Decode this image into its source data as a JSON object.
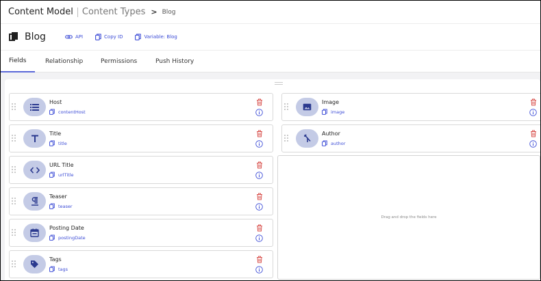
{
  "breadcrumb": {
    "root": "Content Model",
    "section": "Content Types",
    "arrow": ">",
    "current": "Blog"
  },
  "content_type": {
    "title": "Blog",
    "links": [
      {
        "label": "API",
        "icon": "link-icon"
      },
      {
        "label": "Copy ID",
        "icon": "copy-icon"
      },
      {
        "label": "Variable: Blog",
        "icon": "copy-icon"
      }
    ]
  },
  "tabs": [
    {
      "label": "Fields",
      "active": true
    },
    {
      "label": "Relationship",
      "active": false
    },
    {
      "label": "Permissions",
      "active": false
    },
    {
      "label": "Push History",
      "active": false
    }
  ],
  "fields_left": [
    {
      "name": "Host",
      "variable": "contentHost",
      "icon": "list-icon"
    },
    {
      "name": "Title",
      "variable": "title",
      "icon": "text-icon"
    },
    {
      "name": "URL Title",
      "variable": "urlTitle",
      "icon": "code-icon"
    },
    {
      "name": "Teaser",
      "variable": "teaser",
      "icon": "paragraph-icon"
    },
    {
      "name": "Posting Date",
      "variable": "postingDate",
      "icon": "calendar-icon"
    },
    {
      "name": "Tags",
      "variable": "tags",
      "icon": "tag-icon"
    }
  ],
  "fields_right": [
    {
      "name": "Image",
      "variable": "image",
      "icon": "image-icon"
    },
    {
      "name": "Author",
      "variable": "author",
      "icon": "relationship-icon"
    }
  ],
  "dropzone": {
    "text": "Drag and drop the fields here"
  },
  "colors": {
    "accent": "#3b4bd6",
    "icon_bg": "#c4cbe6",
    "icon_fg": "#2b3a8f",
    "delete": "#d9534f",
    "tab_underline": "#5a67d8"
  }
}
